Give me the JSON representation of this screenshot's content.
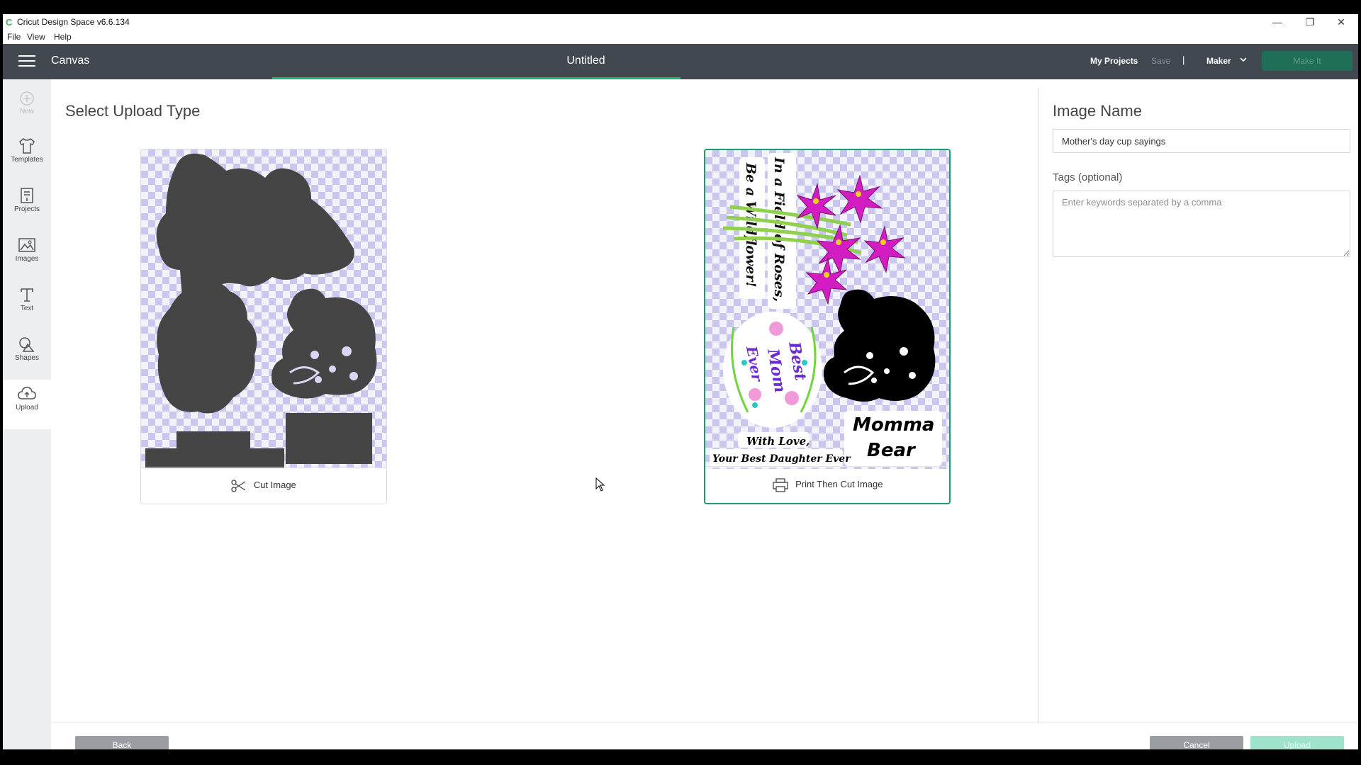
{
  "window": {
    "title": "Cricut Design Space  v6.6.134",
    "minimize_glyph": "—",
    "restore_glyph": "❐",
    "close_glyph": "✕"
  },
  "menu": [
    "File",
    "View",
    "Help"
  ],
  "header": {
    "canvas_label": "Canvas",
    "doc_title": "Untitled",
    "my_projects": "My Projects",
    "save": "Save",
    "separator": "|",
    "machine": "Maker",
    "make_it": "Make It"
  },
  "sidebar": {
    "items": [
      {
        "label": "New",
        "icon": "plus-icon",
        "enabled": false
      },
      {
        "label": "Templates",
        "icon": "tshirt-icon"
      },
      {
        "label": "Projects",
        "icon": "projects-icon"
      },
      {
        "label": "Images",
        "icon": "image-icon"
      },
      {
        "label": "Text",
        "icon": "text-icon"
      },
      {
        "label": "Shapes",
        "icon": "shapes-icon"
      },
      {
        "label": "Upload",
        "icon": "upload-icon",
        "active": true
      }
    ]
  },
  "main": {
    "heading": "Select Upload Type",
    "options": [
      {
        "label": "Cut Image",
        "icon": "scissors-icon",
        "selected": false
      },
      {
        "label": "Print Then Cut Image",
        "icon": "printer-icon",
        "selected": true
      }
    ],
    "preview_text": {
      "vertical_1": "Be a Wildflower!",
      "vertical_2": "In a Field of Roses,",
      "badge_1": "Best",
      "badge_2": "Mom",
      "badge_3": "Ever",
      "momma_1": "Momma",
      "momma_2": "Bear",
      "love_1": "With Love,",
      "love_2": "Your Best Daughter Ever"
    }
  },
  "right_panel": {
    "image_name_label": "Image Name",
    "image_name_value": "Mother's day cup sayings",
    "tags_label": "Tags (optional)",
    "tags_placeholder": "Enter keywords separated by a comma"
  },
  "footer": {
    "back": "Back",
    "cancel": "Cancel",
    "upload": "Upload"
  },
  "colors": {
    "header_bg": "#414850",
    "accent_green": "#21b573",
    "selected_border": "#1c9a72"
  }
}
